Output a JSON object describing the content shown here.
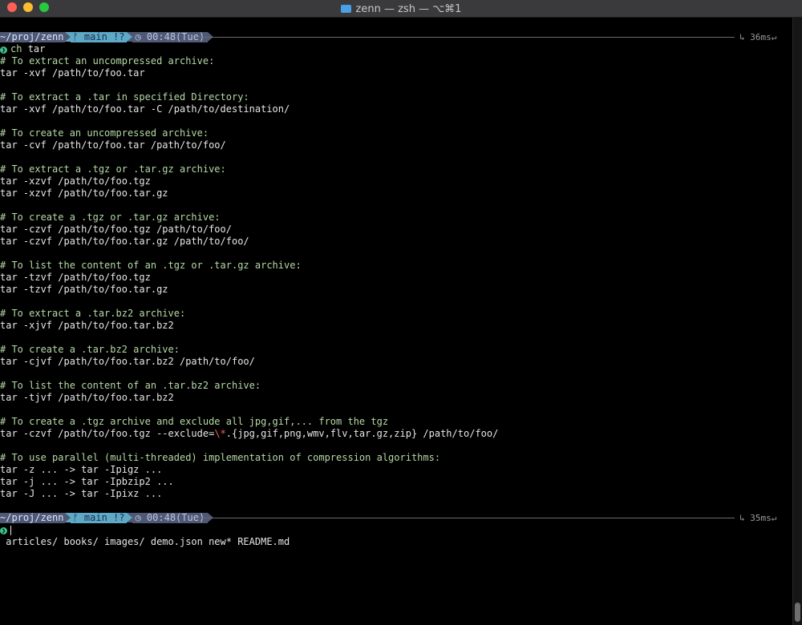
{
  "window": {
    "title": "zenn — zsh — ⌥⌘1"
  },
  "prompt1": {
    "dir": "~/proj/zenn",
    "git": "ᚠ main !?",
    "time": "◷ 00:48(Tue)",
    "right": "↳ 36ms↵"
  },
  "command1": "tar",
  "command1_prefix": "ch",
  "output": [
    {
      "t": "# To extract an uncompressed archive:",
      "k": "c"
    },
    {
      "t": "tar -xvf /path/to/foo.tar",
      "k": "o"
    },
    {
      "t": "",
      "k": "o"
    },
    {
      "t": "# To extract a .tar in specified Directory:",
      "k": "c"
    },
    {
      "t": "tar -xvf /path/to/foo.tar -C /path/to/destination/",
      "k": "o"
    },
    {
      "t": "",
      "k": "o"
    },
    {
      "t": "# To create an uncompressed archive:",
      "k": "c"
    },
    {
      "t": "tar -cvf /path/to/foo.tar /path/to/foo/",
      "k": "o"
    },
    {
      "t": "",
      "k": "o"
    },
    {
      "t": "# To extract a .tgz or .tar.gz archive:",
      "k": "c"
    },
    {
      "t": "tar -xzvf /path/to/foo.tgz",
      "k": "o"
    },
    {
      "t": "tar -xzvf /path/to/foo.tar.gz",
      "k": "o"
    },
    {
      "t": "",
      "k": "o"
    },
    {
      "t": "# To create a .tgz or .tar.gz archive:",
      "k": "c"
    },
    {
      "t": "tar -czvf /path/to/foo.tgz /path/to/foo/",
      "k": "o"
    },
    {
      "t": "tar -czvf /path/to/foo.tar.gz /path/to/foo/",
      "k": "o"
    },
    {
      "t": "",
      "k": "o"
    },
    {
      "t": "# To list the content of an .tgz or .tar.gz archive:",
      "k": "c"
    },
    {
      "t": "tar -tzvf /path/to/foo.tgz",
      "k": "o"
    },
    {
      "t": "tar -tzvf /path/to/foo.tar.gz",
      "k": "o"
    },
    {
      "t": "",
      "k": "o"
    },
    {
      "t": "# To extract a .tar.bz2 archive:",
      "k": "c"
    },
    {
      "t": "tar -xjvf /path/to/foo.tar.bz2",
      "k": "o"
    },
    {
      "t": "",
      "k": "o"
    },
    {
      "t": "# To create a .tar.bz2 archive:",
      "k": "c"
    },
    {
      "t": "tar -cjvf /path/to/foo.tar.bz2 /path/to/foo/",
      "k": "o"
    },
    {
      "t": "",
      "k": "o"
    },
    {
      "t": "# To list the content of an .tar.bz2 archive:",
      "k": "c"
    },
    {
      "t": "tar -tjvf /path/to/foo.tar.bz2",
      "k": "o"
    },
    {
      "t": "",
      "k": "o"
    },
    {
      "t": "# To create a .tgz archive and exclude all jpg,gif,... from the tgz",
      "k": "c"
    },
    {
      "t": "tar -czvf /path/to/foo.tgz --exclude=",
      "k": "o",
      "red": "\\*",
      "after": ".{jpg,gif,png,wmv,flv,tar.gz,zip} /path/to/foo/"
    },
    {
      "t": "",
      "k": "o"
    },
    {
      "t": "# To use parallel (multi-threaded) implementation of compression algorithms:",
      "k": "c"
    },
    {
      "t": "tar -z ... -> tar -Ipigz ...",
      "k": "o"
    },
    {
      "t": "tar -j ... -> tar -Ipbzip2 ...",
      "k": "o"
    },
    {
      "t": "tar -J ... -> tar -Ipixz ...",
      "k": "o"
    }
  ],
  "prompt2": {
    "dir": "~/proj/zenn",
    "git": "ᚠ main !?",
    "time": "◷ 00:48(Tue)",
    "right": "↳ 35ms↵"
  },
  "completions": " articles/ books/ images/ demo.json new* README.md",
  "colors": {
    "comment": "#b5d9a6",
    "text": "#e6e6e6",
    "prompt": "#3cc08a",
    "dir_bg": "#4f5874",
    "git_bg": "#5ea9c5"
  }
}
